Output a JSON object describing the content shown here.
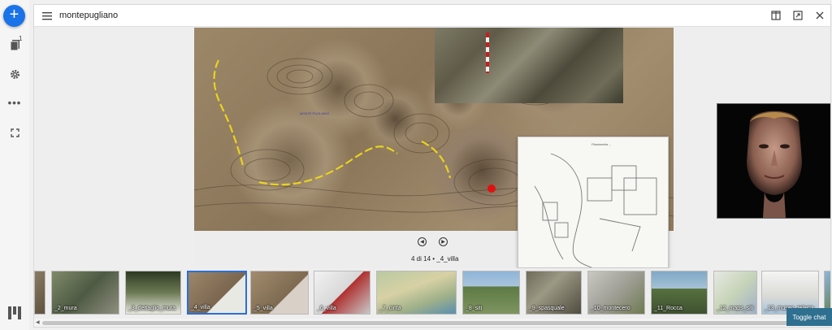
{
  "window": {
    "title": "montepugliano"
  },
  "rail": {
    "add_button": "+",
    "bookmarks_badge": "1",
    "more_label": "•••"
  },
  "viewer": {
    "map_label": "MONTE PUGLIANO",
    "plan_heading": "Planimetria ...",
    "counter": "4 di 14 • _4_villa",
    "prev_symbol": "◀",
    "next_symbol": "▶"
  },
  "thumbnails": [
    {
      "label": ""
    },
    {
      "label": "_2_mura"
    },
    {
      "label": "_3_dettaglio_mura"
    },
    {
      "label": "_4_villa",
      "active": true
    },
    {
      "label": "_5_villa"
    },
    {
      "label": "_6_villa"
    },
    {
      "label": "_7_cinta"
    },
    {
      "label": "_8_siti"
    },
    {
      "label": "_9_spasquale"
    },
    {
      "label": "_10_montecero"
    },
    {
      "label": "_11_Rocca"
    },
    {
      "label": "_12_maps_siti"
    },
    {
      "label": "_13_museo_telesia"
    },
    {
      "label": ""
    }
  ],
  "chat": {
    "toggle_label": "Toggle chat"
  },
  "colors": {
    "accent": "#1a73e8",
    "active_border": "#2a6fdb",
    "chat_button": "#2f6f8f",
    "marker": "#e01010"
  },
  "icons": [
    "add-icon",
    "bookmarks-icon",
    "gear-icon",
    "more-icon",
    "fullscreen-icon",
    "logo-icon",
    "menu-icon",
    "split-view-icon",
    "expand-icon",
    "close-icon",
    "chevron-left-icon",
    "chevron-right-icon"
  ]
}
